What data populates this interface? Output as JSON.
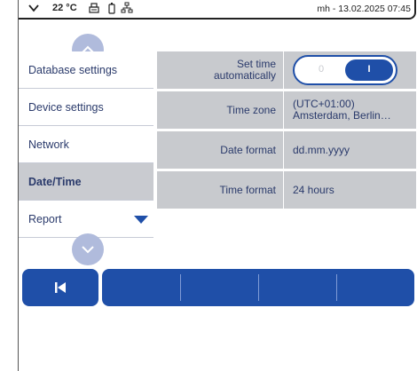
{
  "status_bar": {
    "temperature": "22 °C",
    "icons": [
      "chevron-down-icon",
      "printer-icon",
      "battery-icon",
      "network-icon"
    ],
    "user_datetime": "mh - 13.02.2025 07:45"
  },
  "menu": {
    "items": [
      {
        "label": "Database settings",
        "active": false
      },
      {
        "label": "Device settings",
        "active": false
      },
      {
        "label": "Network",
        "active": false
      },
      {
        "label": "Date/Time",
        "active": true
      },
      {
        "label": "Report",
        "active": false
      }
    ]
  },
  "settings": {
    "set_time": {
      "label": "Set time\nautomatically",
      "off_label": "0",
      "on_label": "I",
      "enabled": true
    },
    "time_zone": {
      "label": "Time zone",
      "value": "(UTC+01:00)\nAmsterdam, Berlin…"
    },
    "date_format": {
      "label": "Date format",
      "value": "dd.mm.yyyy"
    },
    "time_format": {
      "label": "Time format",
      "value": "24 hours"
    }
  },
  "colors": {
    "accent": "#1f4fa8",
    "cell": "#c8cace",
    "text": "#2a3a6b",
    "scroll": "#b0bbdc"
  }
}
